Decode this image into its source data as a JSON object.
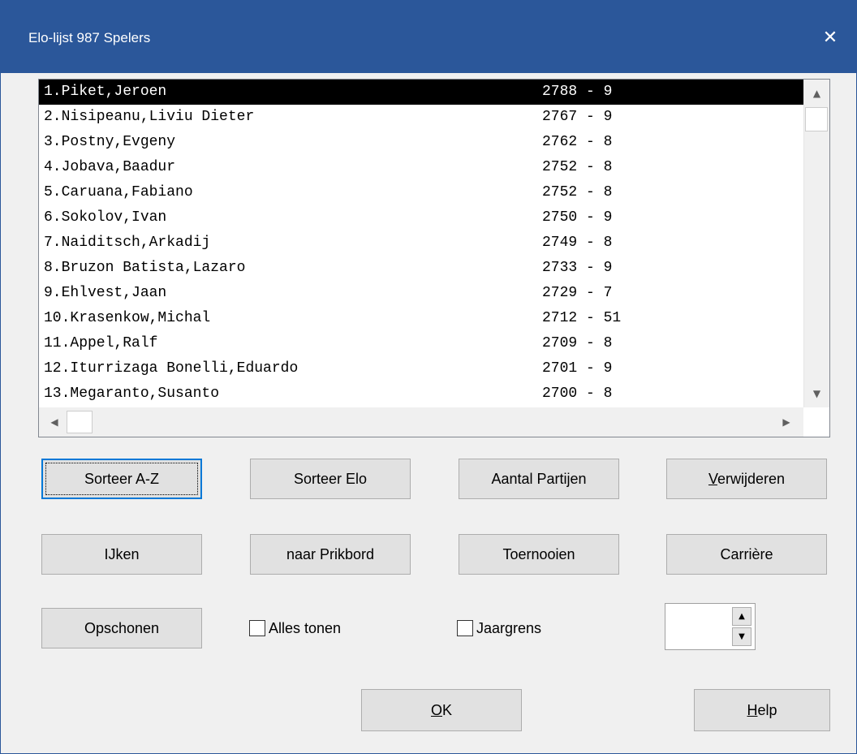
{
  "window": {
    "title": "Elo-lijst 987 Spelers",
    "close_glyph": "✕"
  },
  "players": [
    {
      "name": "1.Piket,Jeroen",
      "rating": "2788 - 9",
      "selected": true
    },
    {
      "name": "2.Nisipeanu,Liviu Dieter",
      "rating": "2767 - 9"
    },
    {
      "name": "3.Postny,Evgeny",
      "rating": "2762 - 8"
    },
    {
      "name": "4.Jobava,Baadur",
      "rating": "2752 - 8"
    },
    {
      "name": "5.Caruana,Fabiano",
      "rating": "2752 - 8"
    },
    {
      "name": "6.Sokolov,Ivan",
      "rating": "2750 - 9"
    },
    {
      "name": "7.Naiditsch,Arkadij",
      "rating": "2749 - 8"
    },
    {
      "name": "8.Bruzon Batista,Lazaro",
      "rating": "2733 - 9"
    },
    {
      "name": "9.Ehlvest,Jaan",
      "rating": "2729 - 7"
    },
    {
      "name": "10.Krasenkow,Michal",
      "rating": "2712 - 51"
    },
    {
      "name": "11.Appel,Ralf",
      "rating": "2709 - 8"
    },
    {
      "name": "12.Iturrizaga Bonelli,Eduardo",
      "rating": "2701 - 9"
    },
    {
      "name": "13.Megaranto,Susanto",
      "rating": "2700 - 8"
    }
  ],
  "buttons": {
    "sort_az": "Sorteer A-Z",
    "sort_elo": "Sorteer Elo",
    "num_games": "Aantal Partijen",
    "delete_mn": "V",
    "delete_rest": "erwijderen",
    "calibrate": "IJken",
    "to_board": "naar Prikbord",
    "tournaments": "Toernooien",
    "career": "Carrière",
    "cleanup": "Opschonen",
    "ok_mn": "O",
    "ok_rest": "K",
    "help_mn": "H",
    "help_rest": "elp"
  },
  "checkboxes": {
    "show_all": {
      "label": "Alles tonen",
      "checked": false
    },
    "year_limit": {
      "label": "Jaargrens",
      "checked": false
    }
  },
  "spinner": {
    "value": ""
  },
  "icons": {
    "up": "▲",
    "down": "▼",
    "left": "◀",
    "right": "▶"
  }
}
